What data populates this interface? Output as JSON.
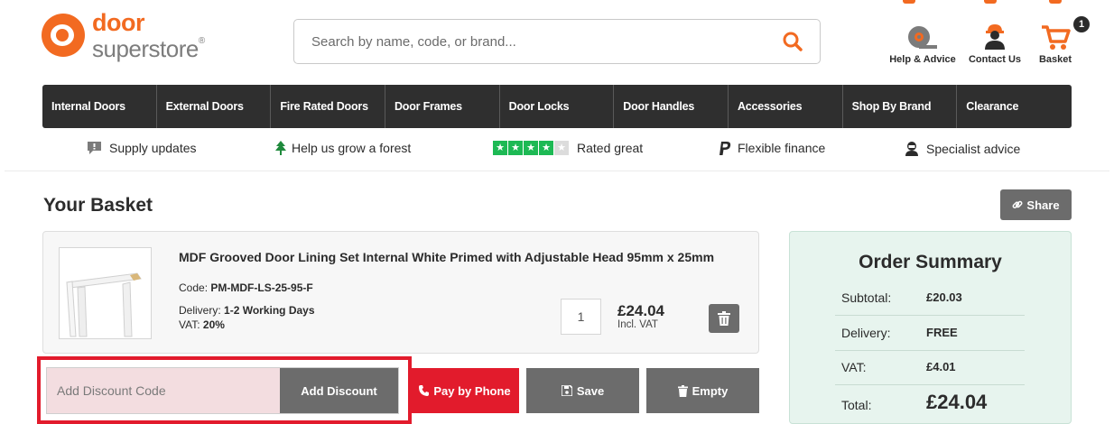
{
  "brand": {
    "line1": "door",
    "line2": "superstore",
    "reg": "®",
    "accent": "#f26a21"
  },
  "search": {
    "placeholder": "Search by name, code, or brand..."
  },
  "header_links": [
    {
      "label": "Help & Advice",
      "icon": "tape-measure-icon"
    },
    {
      "label": "Contact Us",
      "icon": "contact-person-icon"
    },
    {
      "label": "Basket",
      "icon": "cart-icon",
      "badge": "1"
    }
  ],
  "nav": [
    "Internal Doors",
    "External Doors",
    "Fire Rated Doors",
    "Door Frames",
    "Door Locks",
    "Door Handles",
    "Accessories",
    "Shop By Brand",
    "Clearance"
  ],
  "usp": [
    {
      "label": "Supply updates",
      "icon": "speech-bubble-icon"
    },
    {
      "label": "Help us grow a forest",
      "icon": "tree-icon"
    },
    {
      "label": "Rated great",
      "icon": "rating-stars-icon",
      "rating": 4,
      "max": 5
    },
    {
      "label": "Flexible finance",
      "icon": "paypal-icon"
    },
    {
      "label": "Specialist advice",
      "icon": "specialist-icon"
    }
  ],
  "basket": {
    "title": "Your Basket",
    "share_label": "Share"
  },
  "item": {
    "name": "MDF Grooved Door Lining Set Internal White Primed with Adjustable Head 95mm x 25mm",
    "code_label": "Code:",
    "code": "PM-MDF-LS-25-95-F",
    "delivery_label": "Delivery:",
    "delivery": "1-2 Working Days",
    "vat_label": "VAT:",
    "vat": "20%",
    "quantity": "1",
    "price": "£24.04",
    "price_note": "Incl. VAT"
  },
  "discount": {
    "placeholder": "Add Discount Code",
    "button": "Add Discount"
  },
  "actions": {
    "pay_by_phone": "Pay by Phone",
    "save": "Save",
    "empty": "Empty"
  },
  "summary": {
    "title": "Order Summary",
    "subtotal_label": "Subtotal:",
    "subtotal": "£20.03",
    "delivery_label": "Delivery:",
    "delivery": "FREE",
    "vat_label": "VAT:",
    "vat": "£4.01",
    "total_label": "Total:",
    "total": "£24.04"
  }
}
